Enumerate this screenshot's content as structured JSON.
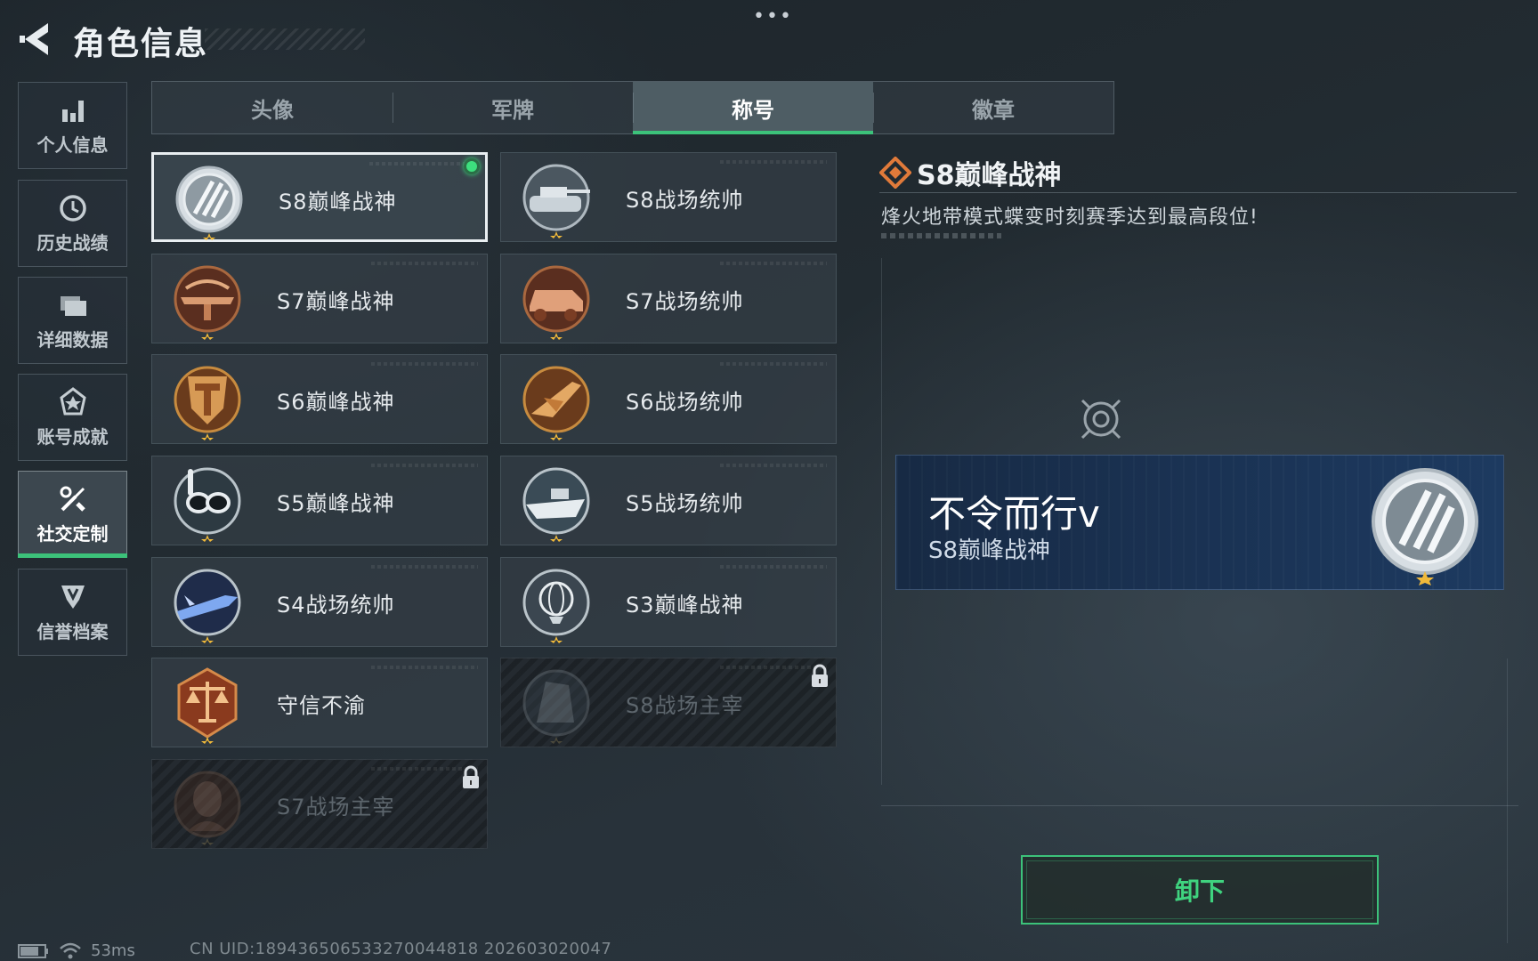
{
  "header": {
    "title": "角色信息",
    "more": "•••"
  },
  "sidebar": {
    "items": [
      {
        "label": "个人信息",
        "icon": "bar-chart-icon"
      },
      {
        "label": "历史战绩",
        "icon": "history-icon"
      },
      {
        "label": "详细数据",
        "icon": "folder-icon"
      },
      {
        "label": "账号成就",
        "icon": "achievement-icon"
      },
      {
        "label": "社交定制",
        "icon": "tools-icon",
        "active": true
      },
      {
        "label": "信誉档案",
        "icon": "credit-shield-icon"
      }
    ]
  },
  "tabs": [
    {
      "label": "头像"
    },
    {
      "label": "军牌"
    },
    {
      "label": "称号",
      "active": true
    },
    {
      "label": "徽章"
    }
  ],
  "titles": [
    {
      "name": "S8巅峰战神",
      "emblem": "s8-peak-emblem",
      "selected": true,
      "equipped": true
    },
    {
      "name": "S8战场统帅",
      "emblem": "tank-emblem"
    },
    {
      "name": "S7巅峰战神",
      "emblem": "crossbow-emblem"
    },
    {
      "name": "S7战场统帅",
      "emblem": "armored-vehicle-emblem"
    },
    {
      "name": "S6巅峰战神",
      "emblem": "shield-t-emblem"
    },
    {
      "name": "S6战场统帅",
      "emblem": "jet-emblem"
    },
    {
      "name": "S5巅峰战神",
      "emblem": "diving-mask-emblem"
    },
    {
      "name": "S5战场统帅",
      "emblem": "speedboat-emblem"
    },
    {
      "name": "S4战场统帅",
      "emblem": "missile-emblem"
    },
    {
      "name": "S3巅峰战神",
      "emblem": "globe-emblem"
    },
    {
      "name": "守信不渝",
      "emblem": "scales-emblem"
    },
    {
      "name": "S8战场主宰",
      "emblem": "building-emblem",
      "locked": true
    },
    {
      "name": "S7战场主宰",
      "emblem": "soldier-emblem",
      "locked": true
    }
  ],
  "detail": {
    "title": "S8巅峰战神",
    "description": "烽火地带模式蝶变时刻赛季达到最高段位!",
    "preview": {
      "player_name": "不令而行v",
      "title": "S8巅峰战神"
    },
    "unequip_label": "卸下"
  },
  "status_bar": {
    "ping": "53ms",
    "uid": "CN UID:189436506533270044818 202603020047"
  },
  "colors": {
    "accent_green": "#3cc27a",
    "equipped_dot": "#3ddf7e",
    "banner_blue": "#1a3253",
    "detail_icon_orange": "#e07a3a"
  }
}
